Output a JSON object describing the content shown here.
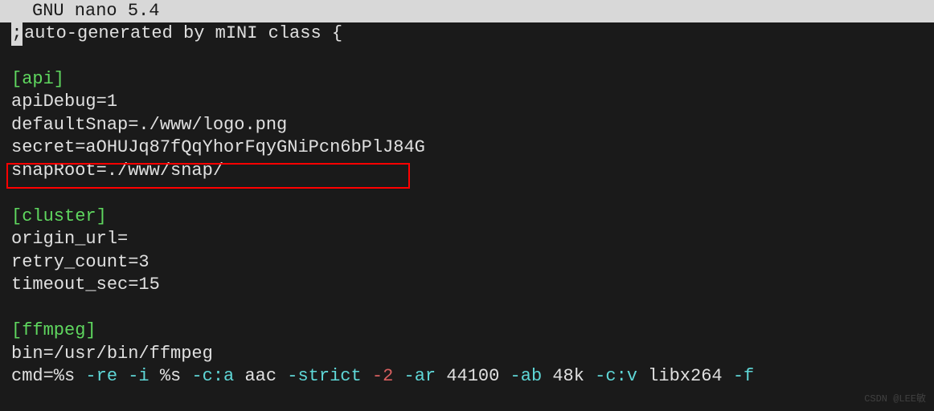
{
  "title_bar": {
    "text": "GNU nano 5.4"
  },
  "editor": {
    "cursor_char": ";",
    "comment_line": " auto-generated by mINI class {",
    "sections": {
      "api": {
        "header": "[api]",
        "lines": [
          "apiDebug=1",
          "defaultSnap=./www/logo.png",
          "secret=aOHUJq87fQqYhorFqyGNiPcn6bPlJ84G",
          "snapRoot=./www/snap/"
        ]
      },
      "cluster": {
        "header": "[cluster]",
        "lines": [
          "origin_url=",
          "retry_count=3",
          "timeout_sec=15"
        ]
      },
      "ffmpeg": {
        "header": "[ffmpeg]",
        "bin_line": "bin=/usr/bin/ffmpeg",
        "cmd_parts": {
          "p0": "cmd=%s ",
          "p1": "-re",
          "p2": " ",
          "p3": "-i",
          "p4": " %s ",
          "p5": "-c:a",
          "p6": " aac ",
          "p7": "-strict",
          "p8": " ",
          "p9": "-2",
          "p10": " ",
          "p11": "-ar",
          "p12": " 44100 ",
          "p13": "-ab",
          "p14": " 48k ",
          "p15": "-c:v",
          "p16": " libx264 ",
          "p17": "-f"
        }
      }
    }
  },
  "watermark": "CSDN @LEE敏"
}
